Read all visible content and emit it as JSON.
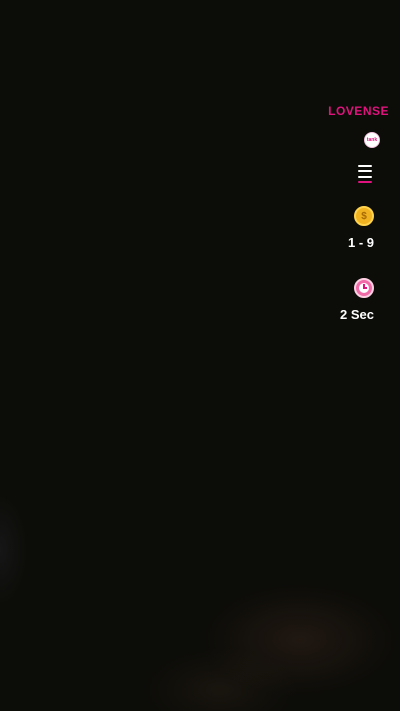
{
  "overlay": {
    "brand": "LOVENSE",
    "badge_text": "tank",
    "menu_icon": "hamburger-menu-icon",
    "tip_range": {
      "icon": "coin-icon",
      "value": "1 - 9"
    },
    "duration": {
      "icon": "clock-icon",
      "value": "2 Sec"
    }
  },
  "colors": {
    "background": "#0c0c08",
    "brand": "#e0137e",
    "coin": "#f0b221",
    "clock": "#f06ba8",
    "text": "#ffffff"
  }
}
